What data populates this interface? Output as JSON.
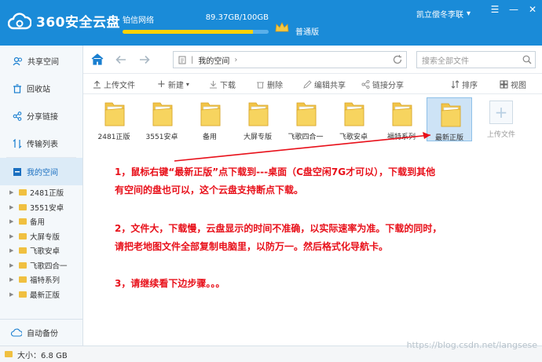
{
  "app": {
    "title": "360安全云盘",
    "network": "铂信网络",
    "storage_text": "89.37GB/100GB",
    "storage_fraction": 0.894,
    "vip_label": "普通版",
    "username": "凯立偿冬李联"
  },
  "sidebar": {
    "items": [
      {
        "label": "共享空间",
        "icon": "users-icon"
      },
      {
        "label": "回收站",
        "icon": "trash-icon"
      },
      {
        "label": "分享链接",
        "icon": "share-icon"
      },
      {
        "label": "传输列表",
        "icon": "transfer-icon"
      },
      {
        "label": "我的空间",
        "icon": "my-space-icon"
      }
    ],
    "tree": [
      "2481正版",
      "3551安卓",
      "备用",
      "大屏专版",
      "飞歌安卓",
      "飞歌四合一",
      "福特系列",
      "最新正版"
    ],
    "auto_backup": "自动备份"
  },
  "nav": {
    "path": "我的空间",
    "search_placeholder": "搜索全部文件"
  },
  "toolbar": {
    "upload": "上传文件",
    "new": "新建",
    "download": "下载",
    "delete": "删除",
    "edit_share": "编辑共享",
    "link_share": "链接分享",
    "sort": "排序",
    "view": "视图"
  },
  "files": [
    {
      "name": "2481正版"
    },
    {
      "name": "3551安卓"
    },
    {
      "name": "备用"
    },
    {
      "name": "大屏专版"
    },
    {
      "name": "飞歌四合一"
    },
    {
      "name": "飞歌安卓"
    },
    {
      "name": "福特系列"
    },
    {
      "name": "最新正版",
      "selected": true
    }
  ],
  "upload_tile": "上传文件",
  "notes": [
    "1，鼠标右键“最新正版”点下载到---桌面（C盘空闲7G才可以），下载到其他",
    "有空间的盘也可以，这个云盘支持断点下载。",
    "2，文件大，下载慢，云盘显示的时间不准确，以实际速率为准。下载的同时，",
    "请把老地图文件全部复制电脑里，以防万一。然后格式化导航卡。",
    "3，请继续看下边步骤。。。"
  ],
  "status": {
    "size": "大小：6.8 GB"
  },
  "watermark": "https://blog.csdn.net/langsese",
  "colors": {
    "brand": "#1a8bd8",
    "annotation": "#e8101a",
    "folder": "#f0c040"
  }
}
